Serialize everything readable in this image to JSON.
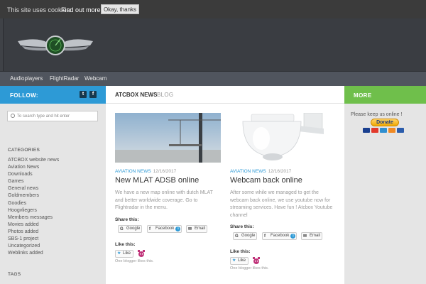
{
  "cookie_bar": {
    "text": "This site uses cookies:",
    "link": "Find out more.",
    "button": "Okay, thanks"
  },
  "nav": {
    "items": [
      "Audioplayers",
      "FlightRadar",
      "Webcam"
    ]
  },
  "sidebar_left": {
    "follow_label": "FOLLOW:",
    "social_icons": [
      "twitter-icon",
      "facebook-icon"
    ],
    "search_placeholder": "To search type and hit enter",
    "categories_title": "CATEGORIES",
    "categories": [
      "ATCBOX website news",
      "Aviation News",
      "Downloads",
      "Games",
      "General news",
      "Goldmembers",
      "Goodies",
      "Hoogvliegers",
      "Members messages",
      "Movies added",
      "Photos added",
      "SBS-1 project",
      "Uncategorized",
      "Weblinks added"
    ],
    "tags_title": "TAGS"
  },
  "main": {
    "heading_bold": "ATCBOX NEWS",
    "heading_light": "BLOG",
    "posts": [
      {
        "category": "AVIATION NEWS",
        "date": "12/16/2017",
        "title": "New MLAT ADSB online",
        "excerpt": "We have a new map online with dutch MLAT and better worldwide coverage. Go to Flightradar in the menu.",
        "share_label": "Share this:",
        "share_buttons": [
          "Google",
          "Facebook",
          "Email"
        ],
        "facebook_count": "1",
        "like_label": "Like this:",
        "like_button": "Like",
        "blogger_text": "One blogger likes this."
      },
      {
        "category": "AVIATION NEWS",
        "date": "12/16/2017",
        "title": "Webcam back online",
        "excerpt": "After some while we managed to get the webcam back online, we use youtube now for streaming services. Have fun ! Atcbox Youtube channel",
        "share_label": "Share this:",
        "share_buttons": [
          "Google",
          "Facebook",
          "Email"
        ],
        "facebook_count": "1",
        "like_label": "Like this:",
        "like_button": "Like",
        "blogger_text": "One blogger likes this."
      }
    ]
  },
  "sidebar_right": {
    "more_label": "MORE",
    "keep_text": "Please keep us online !",
    "donate_label": "Donate",
    "card_icons": [
      "visa-card-icon",
      "mastercard-icon",
      "amex-card-icon",
      "discover-card-icon",
      "paypal-card-icon"
    ]
  },
  "colors": {
    "accent_blue": "#2d9ad6",
    "accent_green": "#6fbf4b",
    "header_dark": "#3a3d42",
    "nav_gray": "#50555e"
  }
}
